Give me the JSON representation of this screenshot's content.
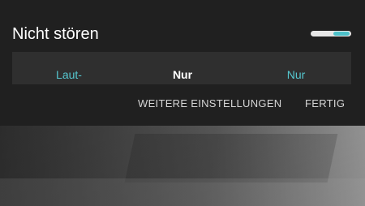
{
  "dialog": {
    "title": "Nicht stören",
    "toggle": {
      "state": "on",
      "track_color": "#e6e6e6",
      "thumb_color": "#4dc1c9"
    },
    "modes": [
      {
        "label": "Laut-",
        "selected": false
      },
      {
        "label": "Nur",
        "selected": true
      },
      {
        "label": "Nur",
        "selected": false
      }
    ],
    "actions": {
      "more_settings": "WEITERE EINSTELLUNGEN",
      "done": "FERTIG"
    }
  },
  "colors": {
    "panel_bg": "#202020",
    "modes_bg": "#2f2f2f",
    "accent": "#55c7cf",
    "text_primary": "#ffffff",
    "text_secondary": "#d5d5d5"
  }
}
